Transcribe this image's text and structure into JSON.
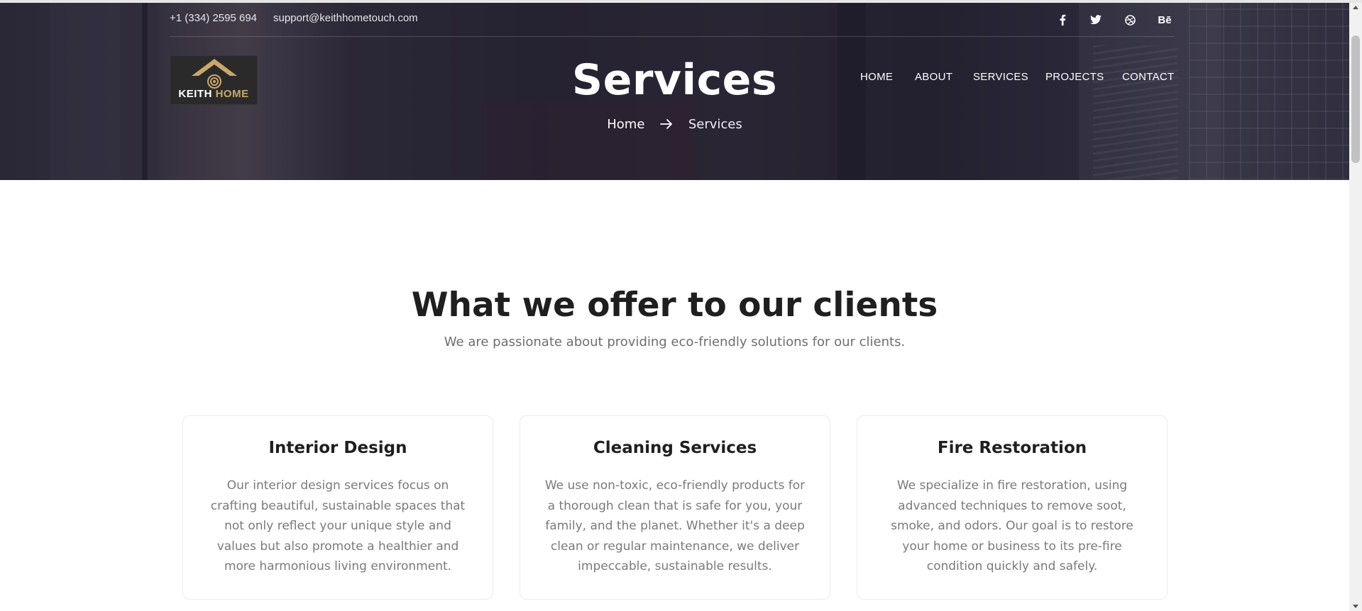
{
  "header": {
    "phone": "+1 (334) 2595 694",
    "email": "support@keithhometouch.com",
    "social": [
      {
        "icon": "facebook-icon",
        "label": "f"
      },
      {
        "icon": "twitter-icon",
        "label": "twitter"
      },
      {
        "icon": "dribbble-icon",
        "label": "dribbble"
      },
      {
        "icon": "behance-icon",
        "label": "Bē"
      }
    ]
  },
  "logo": {
    "word1": "KEITH",
    "word2": "HOME",
    "accent_color": "#c9a86a"
  },
  "nav": {
    "items": [
      {
        "label": "HOME"
      },
      {
        "label": "ABOUT"
      },
      {
        "label": "SERVICES"
      },
      {
        "label": "PROJECTS"
      },
      {
        "label": "CONTACT"
      }
    ]
  },
  "hero": {
    "title": "Services",
    "breadcrumb": {
      "home": "Home",
      "current": "Services"
    }
  },
  "offer": {
    "title": "What we offer to our clients",
    "subtitle": "We are passionate about providing eco-friendly solutions for our clients."
  },
  "services": [
    {
      "title": "Interior Design",
      "text": "Our interior design services focus on crafting beautiful, sustainable spaces that not only reflect your unique style and values but also promote a healthier and more harmonious living environment."
    },
    {
      "title": "Cleaning Services",
      "text": "We use non-toxic, eco-friendly products for a thorough clean that is safe for you, your family, and the planet. Whether it's a deep clean or regular maintenance, we deliver impeccable, sustainable results."
    },
    {
      "title": "Fire Restoration",
      "text": "We specialize in fire restoration, using advanced techniques to remove soot, smoke, and odors. Our goal is to restore your home or business to its pre-fire condition quickly and safely."
    }
  ]
}
